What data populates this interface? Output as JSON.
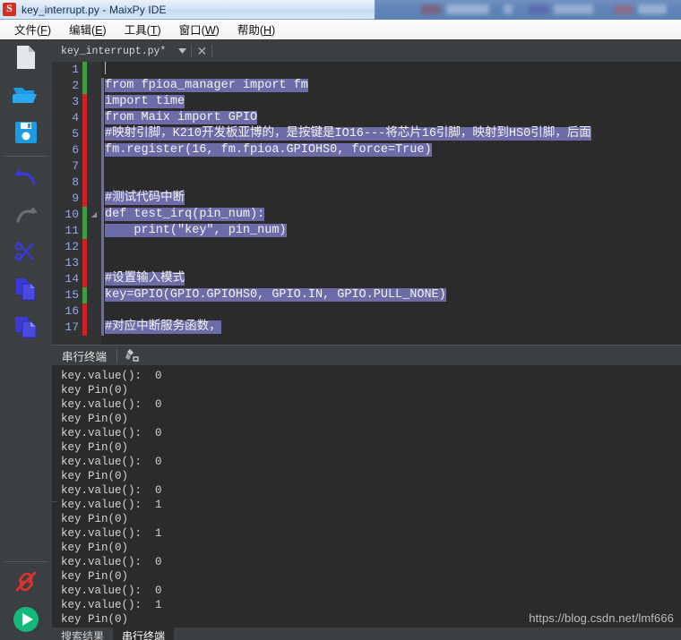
{
  "window": {
    "title": "key_interrupt.py - MaixPy IDE",
    "app_icon": "maixpy-logo-icon"
  },
  "menubar": {
    "items": [
      {
        "label": "文件(F)",
        "text": "文件(",
        "mnemonic": "F",
        "tail": ")"
      },
      {
        "label": "编辑(E)",
        "text": "编辑(",
        "mnemonic": "E",
        "tail": ")"
      },
      {
        "label": "工具(T)",
        "text": "工具(",
        "mnemonic": "T",
        "tail": ")"
      },
      {
        "label": "窗口(W)",
        "text": "窗口(",
        "mnemonic": "W",
        "tail": ")"
      },
      {
        "label": "帮助(H)",
        "text": "帮助(",
        "mnemonic": "H",
        "tail": ")"
      }
    ]
  },
  "toolbar": {
    "buttons": [
      {
        "name": "new-file-icon",
        "tooltip": "新建"
      },
      {
        "name": "open-folder-icon",
        "tooltip": "打开"
      },
      {
        "name": "save-icon",
        "tooltip": "保存"
      },
      {
        "name": "undo-icon",
        "tooltip": "撤销"
      },
      {
        "name": "redo-icon",
        "tooltip": "重做"
      },
      {
        "name": "cut-icon",
        "tooltip": "剪切"
      },
      {
        "name": "copy-icon",
        "tooltip": "复制"
      },
      {
        "name": "paste-icon",
        "tooltip": "粘贴"
      },
      {
        "name": "disconnect-icon",
        "tooltip": "断开连接"
      },
      {
        "name": "run-icon",
        "tooltip": "运行"
      }
    ],
    "colors": {
      "blue": "#2196e3",
      "indigo": "#3a3ad6",
      "gray_disabled": "#6a6e70",
      "red": "#e03131",
      "green": "#14b87a"
    }
  },
  "tab": {
    "filename": "key_interrupt.py*",
    "chevron": "▼",
    "close": "✕"
  },
  "editor": {
    "lines": [
      {
        "n": "1",
        "text": "",
        "mark": "green",
        "fold": "",
        "caret": true
      },
      {
        "n": "2",
        "text": "from fpioa_manager import fm",
        "mark": "green",
        "fold": ""
      },
      {
        "n": "3",
        "text": "import time",
        "mark": "red",
        "fold": ""
      },
      {
        "n": "4",
        "text": "from Maix import GPIO",
        "mark": "red",
        "fold": ""
      },
      {
        "n": "5",
        "text": "#映射引脚，K210开发板亚博的，是按键是IO16---将芯片16引脚，映射到HS0引脚，后面",
        "mark": "red",
        "fold": ""
      },
      {
        "n": "6",
        "text": "fm.register(16, fm.fpioa.GPIOHS0, force=True)",
        "mark": "red",
        "fold": ""
      },
      {
        "n": "7",
        "text": "",
        "mark": "red",
        "fold": ""
      },
      {
        "n": "8",
        "text": "",
        "mark": "red",
        "fold": ""
      },
      {
        "n": "9",
        "text": "#测试代码中断",
        "mark": "red",
        "fold": ""
      },
      {
        "n": "10",
        "text": "def test_irq(pin_num):",
        "mark": "green",
        "fold": "◢"
      },
      {
        "n": "11",
        "text": "    print(\"key\", pin_num)",
        "mark": "green",
        "fold": ""
      },
      {
        "n": "12",
        "text": "",
        "mark": "red",
        "fold": ""
      },
      {
        "n": "13",
        "text": "",
        "mark": "red",
        "fold": ""
      },
      {
        "n": "14",
        "text": "#设置输入模式",
        "mark": "red",
        "fold": ""
      },
      {
        "n": "15",
        "text": "key=GPIO(GPIO.GPIOHS0, GPIO.IN, GPIO.PULL_NONE)",
        "mark": "green",
        "fold": ""
      },
      {
        "n": "16",
        "text": "",
        "mark": "red",
        "fold": ""
      },
      {
        "n": "17",
        "text": "#对应中断服务函数，",
        "mark": "red",
        "fold": ""
      }
    ],
    "selection_color": "#6c6ca8",
    "background": "#2b2b2b"
  },
  "console_header": {
    "label": "串行终端",
    "clear_icon": "clear-broom-icon"
  },
  "console": {
    "lines": [
      "key.value():  0",
      "key Pin(0)",
      "key.value():  0",
      "key Pin(0)",
      "key.value():  0",
      "key Pin(0)",
      "key.value():  0",
      "key Pin(0)",
      "key.value():  0",
      "key.value():  1",
      "key Pin(0)",
      "key.value():  1",
      "key Pin(0)",
      "key.value():  0",
      "key Pin(0)",
      "key.value():  0",
      "key.value():  1",
      "key Pin(0)"
    ]
  },
  "bottom_tabs": {
    "items": [
      {
        "label": "搜索结果",
        "active": false
      },
      {
        "label": "串行终端",
        "active": true
      }
    ]
  },
  "watermark": {
    "text": "https://blog.csdn.net/lmf666"
  }
}
